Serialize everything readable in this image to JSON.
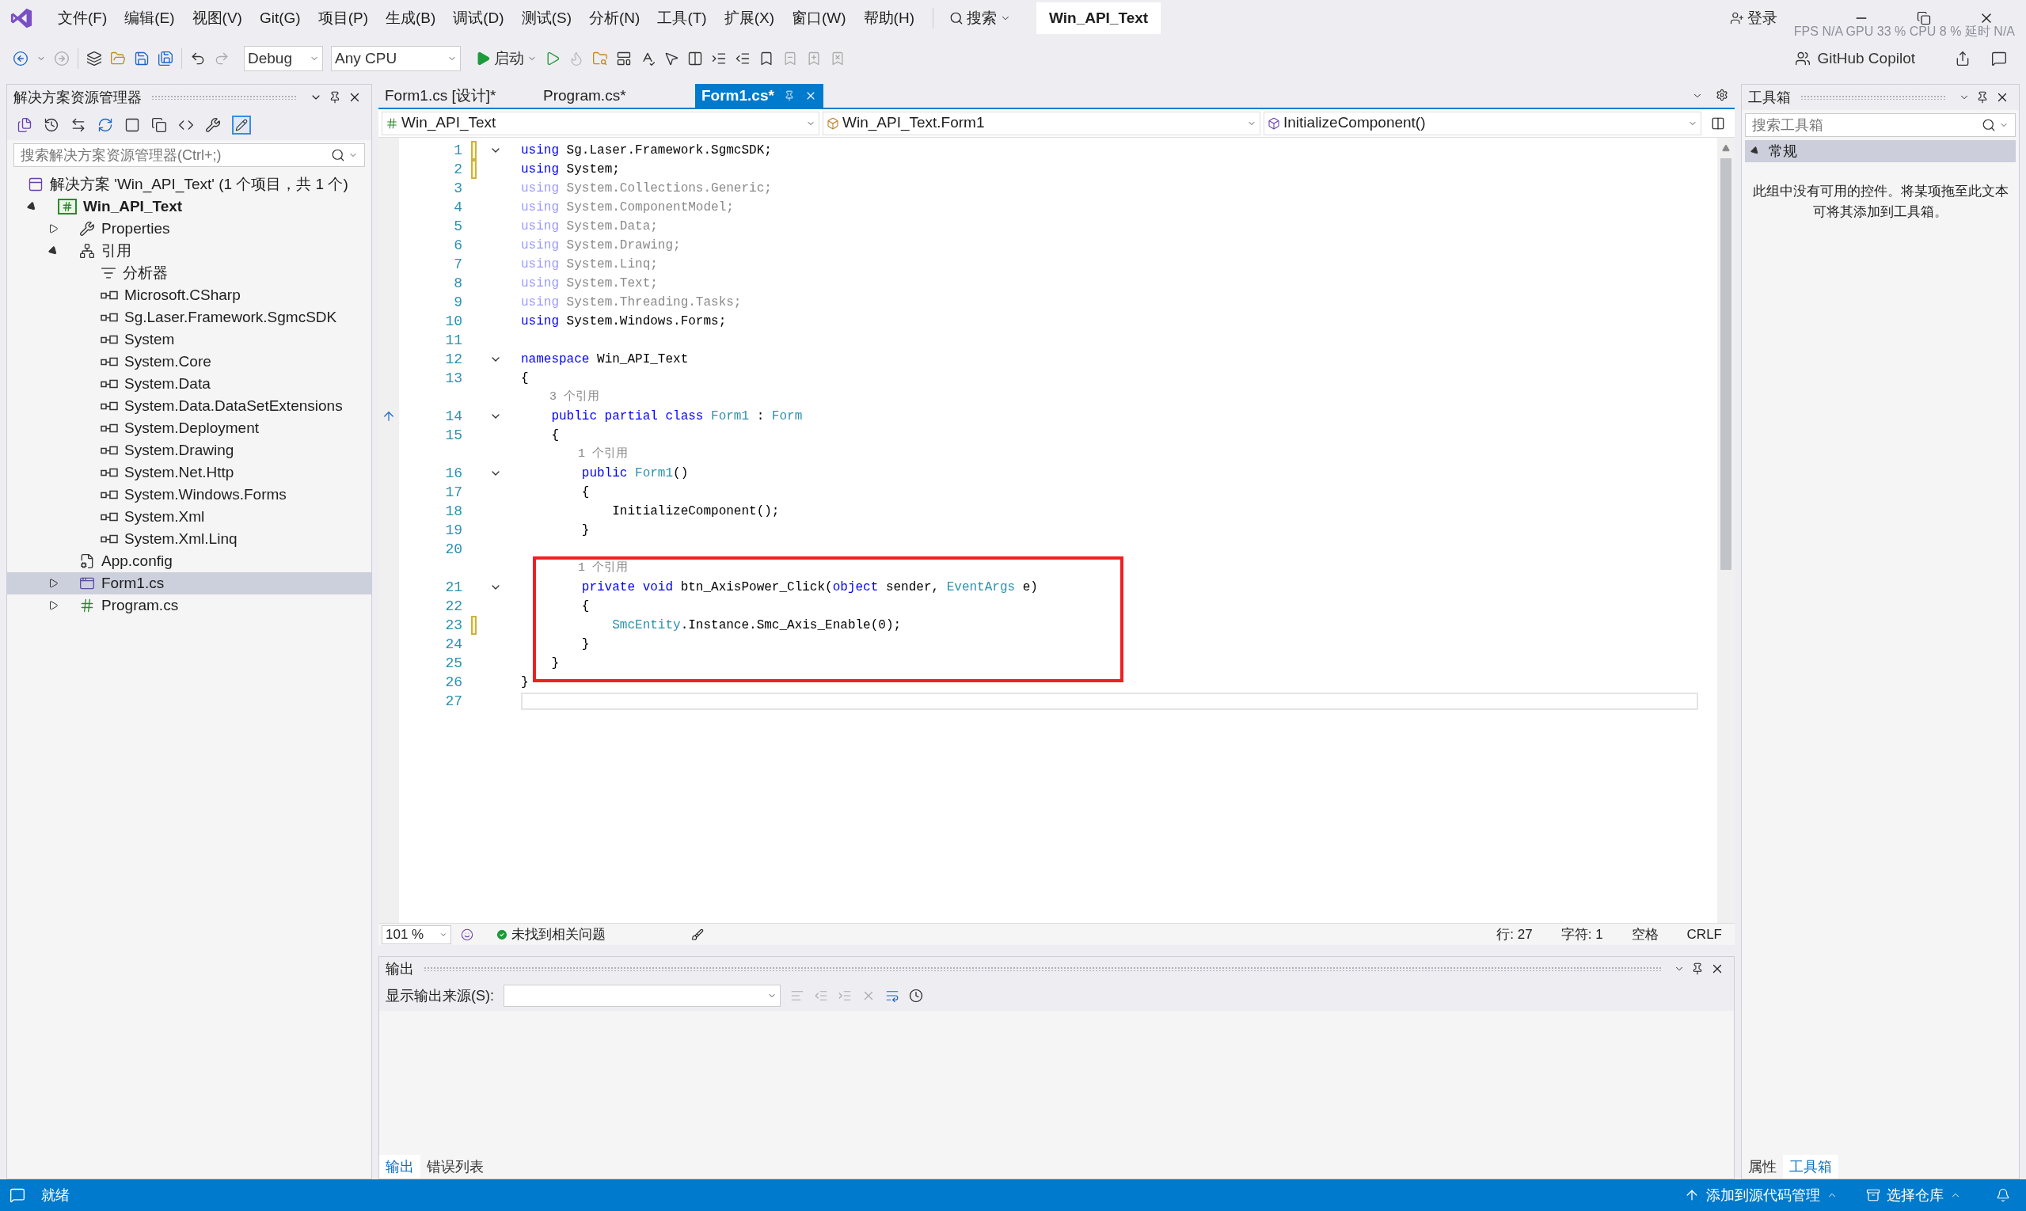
{
  "menu_bar": {
    "items": [
      "文件(F)",
      "编辑(E)",
      "视图(V)",
      "Git(G)",
      "项目(P)",
      "生成(B)",
      "调试(D)",
      "测试(S)",
      "分析(N)",
      "工具(T)",
      "扩展(X)",
      "窗口(W)",
      "帮助(H)"
    ],
    "search": "搜索",
    "solution_title": "Win_API_Text",
    "sign_in": "登录",
    "perf_overlay": "FPS N/A GPU 33 % CPU 8 % 延时 N/A"
  },
  "toolbar": {
    "configuration": "Debug",
    "platform": "Any CPU",
    "start": "启动",
    "copilot": "GitHub Copilot"
  },
  "solution_explorer": {
    "title": "解决方案资源管理器",
    "search": {
      "placeholder": "搜索解决方案资源管理器(Ctrl+;)"
    },
    "tree": [
      {
        "label": "解决方案 'Win_API_Text' (1 个项目，共 1 个)",
        "kind": "solution",
        "selected": false,
        "children": [
          {
            "label": "Win_API_Text",
            "kind": "project",
            "expanded": true,
            "selected": false,
            "children": [
              {
                "label": "Properties",
                "kind": "properties",
                "expanded": false,
                "selected": false
              },
              {
                "label": "引用",
                "kind": "references",
                "expanded": true,
                "selected": false,
                "children": [
                  {
                    "label": "分析器",
                    "kind": "analyzer",
                    "selected": false
                  },
                  {
                    "label": "Microsoft.CSharp",
                    "kind": "reference",
                    "selected": false
                  },
                  {
                    "label": "Sg.Laser.Framework.SgmcSDK",
                    "kind": "reference",
                    "selected": false
                  },
                  {
                    "label": "System",
                    "kind": "reference",
                    "selected": false
                  },
                  {
                    "label": "System.Core",
                    "kind": "reference",
                    "selected": false
                  },
                  {
                    "label": "System.Data",
                    "kind": "reference",
                    "selected": false
                  },
                  {
                    "label": "System.Data.DataSetExtensions",
                    "kind": "reference",
                    "selected": false
                  },
                  {
                    "label": "System.Deployment",
                    "kind": "reference",
                    "selected": false
                  },
                  {
                    "label": "System.Drawing",
                    "kind": "reference",
                    "selected": false
                  },
                  {
                    "label": "System.Net.Http",
                    "kind": "reference",
                    "selected": false
                  },
                  {
                    "label": "System.Windows.Forms",
                    "kind": "reference",
                    "selected": false
                  },
                  {
                    "label": "System.Xml",
                    "kind": "reference",
                    "selected": false
                  },
                  {
                    "label": "System.Xml.Linq",
                    "kind": "reference",
                    "selected": false
                  }
                ]
              },
              {
                "label": "App.config",
                "kind": "config",
                "selected": false
              },
              {
                "label": "Form1.cs",
                "kind": "form",
                "expanded": false,
                "selected": true
              },
              {
                "label": "Program.cs",
                "kind": "csharp",
                "expanded": false,
                "selected": false
              }
            ]
          }
        ]
      }
    ]
  },
  "editor": {
    "tabs": [
      {
        "label": "Form1.cs [设计]*",
        "selected": false
      },
      {
        "label": "Program.cs*",
        "selected": false
      },
      {
        "label": "Form1.cs*",
        "selected": true
      }
    ],
    "nav": [
      "Win_API_Text",
      "Win_API_Text.Form1",
      "InitializeComponent()"
    ],
    "lines": [
      {
        "kind": "code",
        "number": "1",
        "foldable": true,
        "modified": true,
        "tokens": [
          {
            "text": "using",
            "kind": "keyword"
          },
          {
            "text": " Sg.Laser.Framework.SgmcSDK;",
            "kind": "plain"
          }
        ]
      },
      {
        "kind": "code",
        "number": "2",
        "foldable": false,
        "modified": true,
        "tokens": [
          {
            "text": "using",
            "kind": "keyword"
          },
          {
            "text": " System;",
            "kind": "plain"
          }
        ]
      },
      {
        "kind": "code",
        "number": "3",
        "foldable": false,
        "modified": false,
        "tokens": [
          {
            "text": "using",
            "kind": "faded_keyword"
          },
          {
            "text": " System.Collections.Generic;",
            "kind": "faded"
          }
        ]
      },
      {
        "kind": "code",
        "number": "4",
        "foldable": false,
        "modified": false,
        "tokens": [
          {
            "text": "using",
            "kind": "faded_keyword"
          },
          {
            "text": " System.ComponentModel;",
            "kind": "faded"
          }
        ]
      },
      {
        "kind": "code",
        "number": "5",
        "foldable": false,
        "modified": false,
        "tokens": [
          {
            "text": "using",
            "kind": "faded_keyword"
          },
          {
            "text": " System.Data;",
            "kind": "faded"
          }
        ]
      },
      {
        "kind": "code",
        "number": "6",
        "foldable": false,
        "modified": false,
        "tokens": [
          {
            "text": "using",
            "kind": "faded_keyword"
          },
          {
            "text": " System.Drawing;",
            "kind": "faded"
          }
        ]
      },
      {
        "kind": "code",
        "number": "7",
        "foldable": false,
        "modified": false,
        "tokens": [
          {
            "text": "using",
            "kind": "faded_keyword"
          },
          {
            "text": " System.Linq;",
            "kind": "faded"
          }
        ]
      },
      {
        "kind": "code",
        "number": "8",
        "foldable": false,
        "modified": false,
        "tokens": [
          {
            "text": "using",
            "kind": "faded_keyword"
          },
          {
            "text": " System.Text;",
            "kind": "faded"
          }
        ]
      },
      {
        "kind": "code",
        "number": "9",
        "foldable": false,
        "modified": false,
        "tokens": [
          {
            "text": "using",
            "kind": "faded_keyword"
          },
          {
            "text": " System.Threading.Tasks;",
            "kind": "faded"
          }
        ]
      },
      {
        "kind": "code",
        "number": "10",
        "foldable": false,
        "modified": false,
        "tokens": [
          {
            "text": "using",
            "kind": "keyword"
          },
          {
            "text": " System.Windows.Forms;",
            "kind": "plain"
          }
        ]
      },
      {
        "kind": "code",
        "number": "11",
        "foldable": false,
        "modified": false
      },
      {
        "kind": "code",
        "number": "12",
        "foldable": true,
        "modified": false,
        "tokens": [
          {
            "text": "namespace",
            "kind": "keyword"
          },
          {
            "text": " Win_API_Text",
            "kind": "plain"
          }
        ]
      },
      {
        "kind": "code",
        "number": "13",
        "foldable": false,
        "modified": false,
        "tokens": [
          {
            "text": "{",
            "kind": "plain"
          }
        ]
      },
      {
        "kind": "codelens",
        "text": "    3 个引用"
      },
      {
        "kind": "class_line",
        "number": "14",
        "foldable": true,
        "modified": false,
        "tokens": [
          {
            "text": "    public partial class",
            "kind": "keyword"
          },
          {
            "text": " Form1",
            "kind": "type"
          },
          {
            "text": " : ",
            "kind": "plain"
          },
          {
            "text": "Form",
            "kind": "type"
          }
        ]
      },
      {
        "kind": "code",
        "number": "15",
        "foldable": false,
        "modified": false,
        "tokens": [
          {
            "text": "    {",
            "kind": "plain"
          }
        ]
      },
      {
        "kind": "codelens",
        "text": "        1 个引用"
      },
      {
        "kind": "code",
        "number": "16",
        "foldable": true,
        "modified": false,
        "tokens": [
          {
            "text": "        public",
            "kind": "keyword"
          },
          {
            "text": " Form1",
            "kind": "type"
          },
          {
            "text": "()",
            "kind": "plain"
          }
        ]
      },
      {
        "kind": "code",
        "number": "17",
        "foldable": false,
        "modified": false,
        "tokens": [
          {
            "text": "        {",
            "kind": "plain"
          }
        ]
      },
      {
        "kind": "code",
        "number": "18",
        "foldable": false,
        "modified": false,
        "tokens": [
          {
            "text": "            InitializeComponent();",
            "kind": "plain"
          }
        ]
      },
      {
        "kind": "code",
        "number": "19",
        "foldable": false,
        "modified": false,
        "tokens": [
          {
            "text": "        }",
            "kind": "plain"
          }
        ]
      },
      {
        "kind": "code",
        "number": "20",
        "foldable": false,
        "modified": false
      },
      {
        "kind": "codelens",
        "text": "        1 个引用"
      },
      {
        "kind": "code",
        "number": "21",
        "foldable": true,
        "modified": false,
        "tokens": [
          {
            "text": "        private void",
            "kind": "keyword"
          },
          {
            "text": " btn_AxisPower_Click(",
            "kind": "plain"
          },
          {
            "text": "object",
            "kind": "keyword"
          },
          {
            "text": " sender, ",
            "kind": "plain"
          },
          {
            "text": "EventArgs",
            "kind": "type"
          },
          {
            "text": " e)",
            "kind": "plain"
          }
        ]
      },
      {
        "kind": "code",
        "number": "22",
        "foldable": false,
        "modified": false,
        "tokens": [
          {
            "text": "        {",
            "kind": "plain"
          }
        ]
      },
      {
        "kind": "code",
        "number": "23",
        "foldable": false,
        "modified": true,
        "tokens": [
          {
            "text": "            SmcEntity",
            "kind": "type"
          },
          {
            "text": ".Instance.Smc_Axis_Enable(0);",
            "kind": "plain"
          }
        ]
      },
      {
        "kind": "code",
        "number": "24",
        "foldable": false,
        "modified": false,
        "tokens": [
          {
            "text": "        }",
            "kind": "plain"
          }
        ]
      },
      {
        "kind": "code",
        "number": "25",
        "foldable": false,
        "modified": false,
        "tokens": [
          {
            "text": "    }",
            "kind": "plain"
          }
        ]
      },
      {
        "kind": "code",
        "number": "26",
        "foldable": false,
        "modified": false,
        "tokens": [
          {
            "text": "}",
            "kind": "plain"
          }
        ]
      },
      {
        "kind": "current",
        "number": "27",
        "foldable": false,
        "modified": false
      }
    ],
    "status": {
      "zoom": "101 %",
      "issues": "未找到相关问题",
      "line": "行: 27",
      "column": "字符: 1",
      "indent": "空格",
      "line_ending": "CRLF"
    }
  },
  "output": {
    "title": "输出",
    "source_label": "显示输出来源(S):",
    "tabs": [
      {
        "label": "输出",
        "selected": true
      },
      {
        "label": "错误列表",
        "selected": false
      }
    ]
  },
  "toolbox": {
    "title": "工具箱",
    "search": {
      "placeholder": "搜索工具箱"
    },
    "group": {
      "label": "常规",
      "expanded": true
    },
    "empty_message": "此组中没有可用的控件。将某项拖至此文本可将其添加到工具箱。",
    "tabs": [
      {
        "label": "属性",
        "selected": false
      },
      {
        "label": "工具箱",
        "selected": true
      }
    ]
  },
  "status_bar": {
    "status": "就绪",
    "source_control": "添加到源代码管理",
    "repository": "选择仓库"
  }
}
